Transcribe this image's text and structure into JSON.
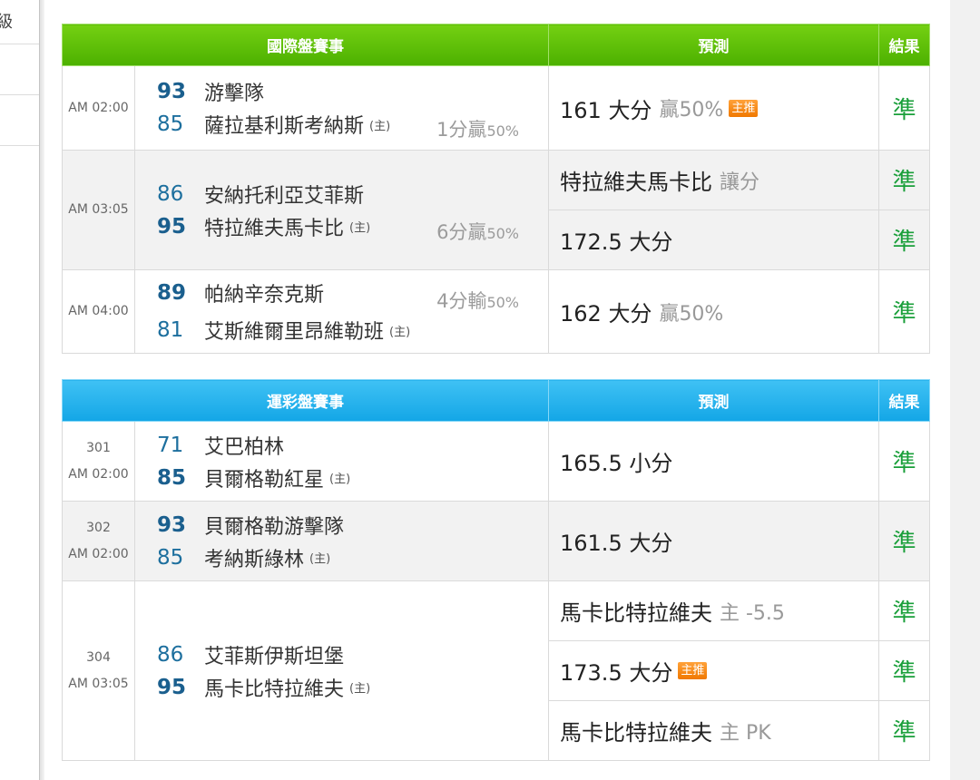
{
  "sidebar": {
    "partial_text": "級"
  },
  "table1": {
    "header": {
      "match": "國際盤賽事",
      "prediction": "預測",
      "result": "結果"
    },
    "home_marker": "(主)",
    "rows": [
      {
        "time": "AM 02:00",
        "team1": {
          "score": "93",
          "name": "游擊隊"
        },
        "team2": {
          "score": "85",
          "name": "薩拉基利斯考納斯"
        },
        "handicap": {
          "value": "1分贏",
          "pct": "50%"
        },
        "preds": [
          {
            "main": "161 大分",
            "sub": "贏50%",
            "badge": "主推",
            "result": "準"
          }
        ]
      },
      {
        "time": "AM 03:05",
        "team1": {
          "score": "86",
          "name": "安納托利亞艾菲斯"
        },
        "team2": {
          "score": "95",
          "name": "特拉維夫馬卡比"
        },
        "handicap": {
          "value": "6分贏",
          "pct": "50%"
        },
        "preds": [
          {
            "main": "特拉維夫馬卡比",
            "sub": "讓分",
            "result": "準"
          },
          {
            "main": "172.5 大分",
            "result": "準"
          }
        ]
      },
      {
        "time": "AM 04:00",
        "team1": {
          "score": "89",
          "name": "帕納辛奈克斯"
        },
        "team2": {
          "score": "81",
          "name": "艾斯維爾里昂維勒班"
        },
        "handicap": {
          "value": "4分輸",
          "pct": "50%"
        },
        "preds": [
          {
            "main": "162 大分",
            "sub": "贏50%",
            "result": "準"
          }
        ]
      }
    ]
  },
  "table2": {
    "header": {
      "match": "運彩盤賽事",
      "prediction": "預測",
      "result": "結果"
    },
    "home_marker": "(主)",
    "rows": [
      {
        "number": "301",
        "time": "AM 02:00",
        "team1": {
          "score": "71",
          "name": "艾巴柏林"
        },
        "team2": {
          "score": "85",
          "name": "貝爾格勒紅星"
        },
        "preds": [
          {
            "main": "165.5 小分",
            "result": "準"
          }
        ]
      },
      {
        "number": "302",
        "time": "AM 02:00",
        "team1": {
          "score": "93",
          "name": "貝爾格勒游擊隊"
        },
        "team2": {
          "score": "85",
          "name": "考納斯綠林"
        },
        "preds": [
          {
            "main": "161.5 大分",
            "result": "準"
          }
        ]
      },
      {
        "number": "304",
        "time": "AM 03:05",
        "team1": {
          "score": "86",
          "name": "艾菲斯伊斯坦堡"
        },
        "team2": {
          "score": "95",
          "name": "馬卡比特拉維夫"
        },
        "preds": [
          {
            "main": "馬卡比特拉維夫",
            "sub": "主 -5.5",
            "result": "準"
          },
          {
            "main": "173.5 大分",
            "badge": "主推",
            "result": "準"
          },
          {
            "main": "馬卡比特拉維夫",
            "sub": "主 PK",
            "result": "準"
          }
        ]
      }
    ]
  },
  "colors": {
    "table1_header": "#5cbf0a",
    "table2_header": "#1eaaea",
    "result_text": "#1a9f3a",
    "score_text": "#1d6f9e",
    "badge": "#f58a12"
  }
}
